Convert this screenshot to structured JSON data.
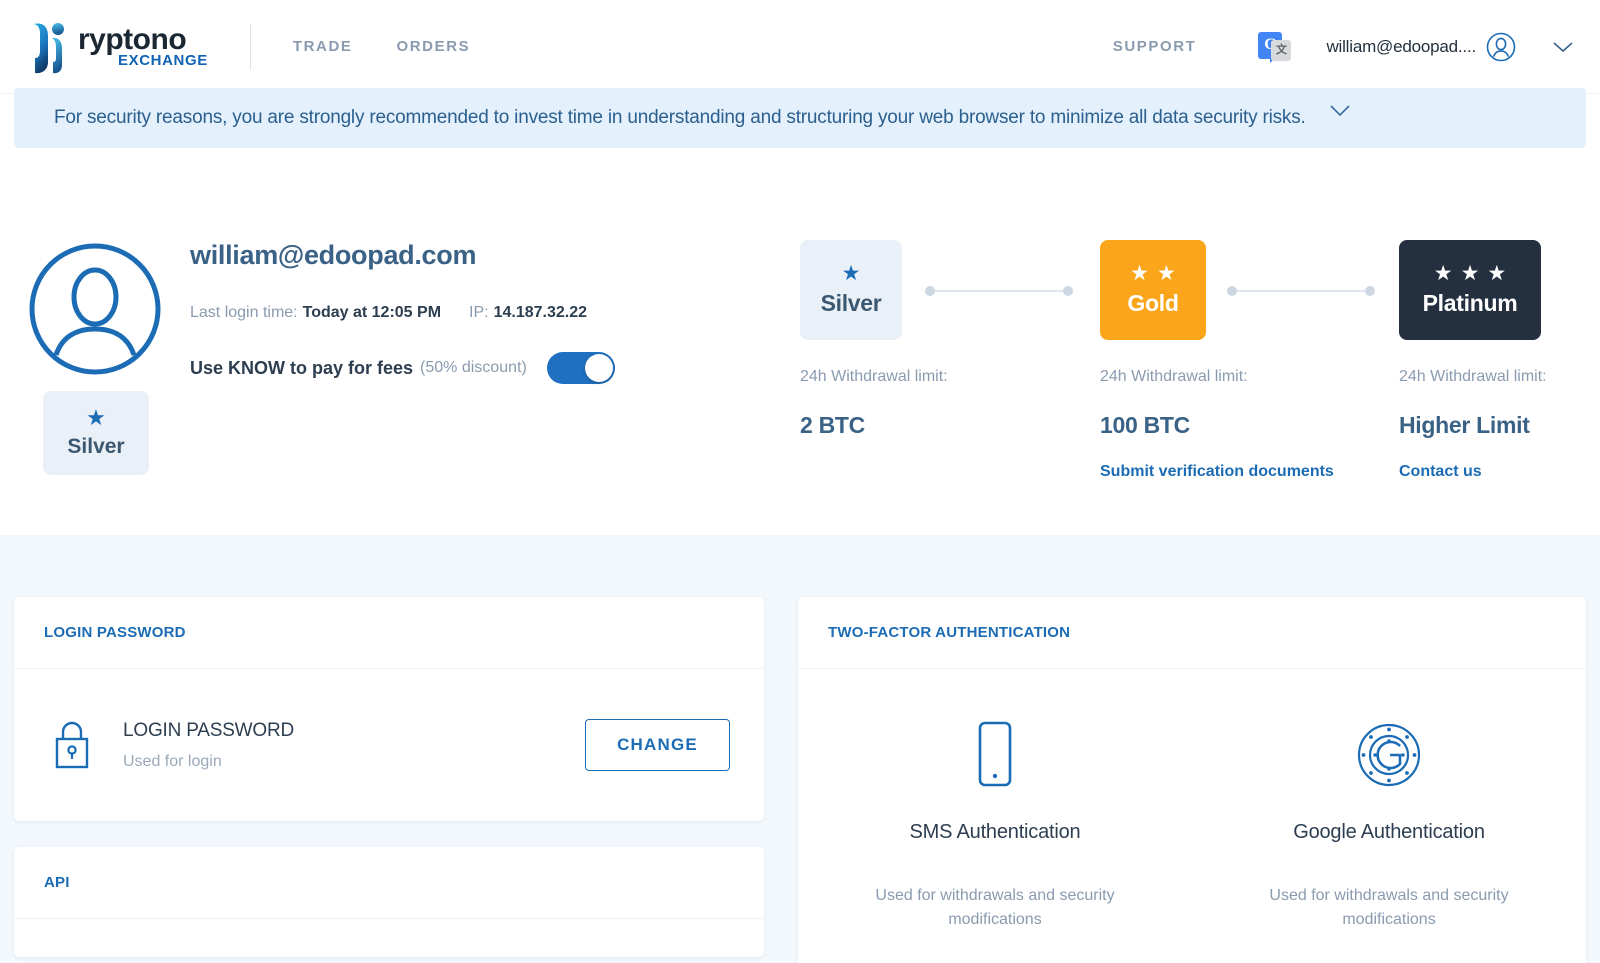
{
  "header": {
    "logo_word": "ryptono",
    "logo_sub": "EXCHANGE",
    "nav": [
      {
        "label": "TRADE"
      },
      {
        "label": "ORDERS"
      }
    ],
    "support_label": "SUPPORT",
    "account_email": "william@edoopad....",
    "translate_icon_letter": "G",
    "translate_icon_glyph": "文"
  },
  "banner": {
    "text": "For security reasons, you are strongly recommended to invest time in understanding and structuring your web browser to minimize all data security risks."
  },
  "profile": {
    "email": "william@edoopad.com",
    "last_login_label": "Last login time:",
    "last_login_value": "Today at 12:05 PM",
    "ip_label": "IP:",
    "ip_value": "14.187.32.22",
    "know_label": "Use KNOW to pay for fees",
    "know_discount": "(50% discount)",
    "know_toggle_on": true,
    "current_tier": "Silver",
    "current_tier_star": "★"
  },
  "tiers": [
    {
      "name": "Silver",
      "stars": "★",
      "star_count": 1,
      "limit_label": "24h Withdrawal limit:",
      "limit_value": "2 BTC",
      "action": "",
      "color": "#e9f0f8"
    },
    {
      "name": "Gold",
      "stars": "★",
      "star_count": 2,
      "limit_label": "24h Withdrawal limit:",
      "limit_value": "100 BTC",
      "action": "Submit verification documents",
      "color": "#faa51a"
    },
    {
      "name": "Platinum",
      "stars": "★",
      "star_count": 3,
      "limit_label": "24h Withdrawal limit:",
      "limit_value": "Higher Limit",
      "action": "Contact us",
      "color": "#24303f"
    }
  ],
  "login_password_card": {
    "header": "LOGIN PASSWORD",
    "row_title": "LOGIN PASSWORD",
    "row_sub": "Used for login",
    "change_label": "CHANGE"
  },
  "api_card": {
    "header": "API"
  },
  "two_factor_card": {
    "header": "TWO-FACTOR AUTHENTICATION",
    "methods": [
      {
        "name": "SMS Authentication",
        "desc": "Used for withdrawals and security modifications"
      },
      {
        "name": "Google Authentication",
        "desc": "Used for withdrawals and security modifications"
      }
    ]
  },
  "colors": {
    "accent_blue": "#1b6cb5",
    "gold": "#faa51a",
    "platinum": "#24303f",
    "silver_bg": "#e9f0f8",
    "banner_bg": "#e4f0fb",
    "section_bg": "#f3f8fd",
    "muted_text": "#8a9bb0"
  }
}
